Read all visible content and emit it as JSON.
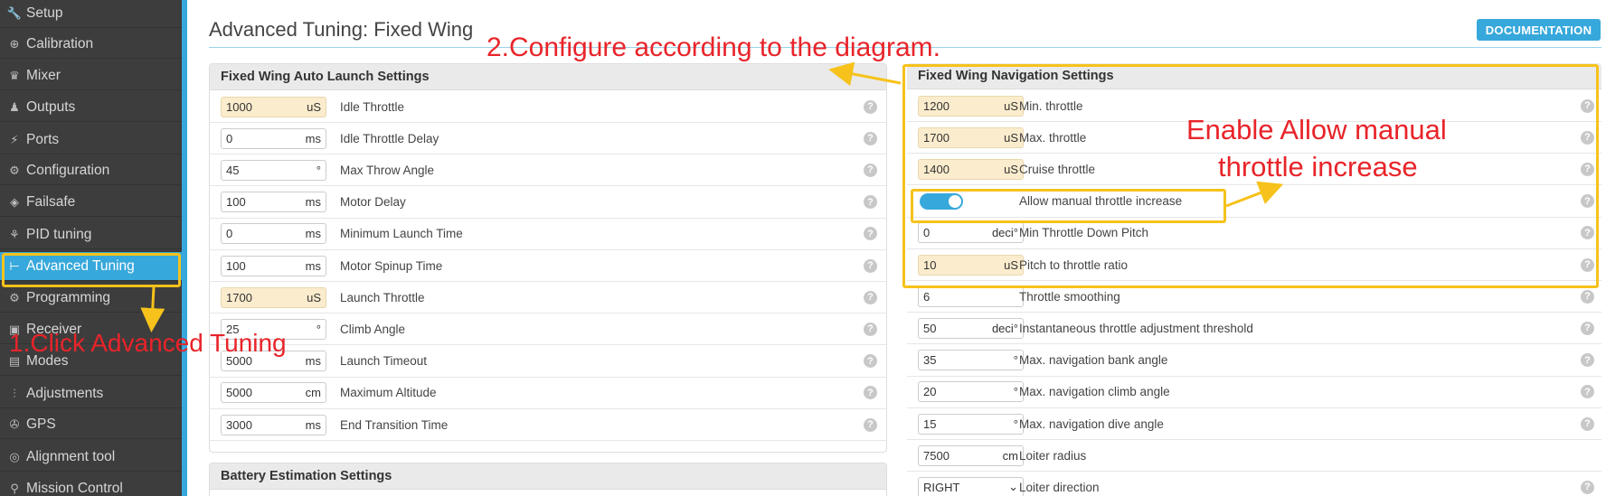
{
  "sidebar": {
    "items": [
      {
        "label": "Setup",
        "icon": "wrench-icon"
      },
      {
        "label": "Calibration",
        "icon": "crosshair-icon"
      },
      {
        "label": "Mixer",
        "icon": "mixer-icon"
      },
      {
        "label": "Outputs",
        "icon": "outputs-icon"
      },
      {
        "label": "Ports",
        "icon": "ports-icon"
      },
      {
        "label": "Configuration",
        "icon": "gear-icon"
      },
      {
        "label": "Failsafe",
        "icon": "failsafe-icon"
      },
      {
        "label": "PID tuning",
        "icon": "pid-icon"
      },
      {
        "label": "Advanced Tuning",
        "icon": "tree-icon"
      },
      {
        "label": "Programming",
        "icon": "gear-icon"
      },
      {
        "label": "Receiver",
        "icon": "receiver-icon"
      },
      {
        "label": "Modes",
        "icon": "modes-icon"
      },
      {
        "label": "Adjustments",
        "icon": "sliders-icon"
      },
      {
        "label": "GPS",
        "icon": "satellite-icon"
      },
      {
        "label": "Alignment tool",
        "icon": "compass-icon"
      },
      {
        "label": "Mission Control",
        "icon": "map-pin-icon"
      }
    ],
    "active_index": 8,
    "active_color": "#37a8db"
  },
  "header": {
    "title": "Advanced Tuning: Fixed Wing",
    "doc_button": "DOCUMENTATION"
  },
  "launch_panel": {
    "title": "Fixed Wing Auto Launch Settings",
    "rows": [
      {
        "value": "1000",
        "unit": "uS",
        "label": "Idle Throttle",
        "warn": true
      },
      {
        "value": "0",
        "unit": "ms",
        "label": "Idle Throttle Delay",
        "warn": false
      },
      {
        "value": "45",
        "unit": "°",
        "label": "Max Throw Angle",
        "warn": false
      },
      {
        "value": "100",
        "unit": "ms",
        "label": "Motor Delay",
        "warn": false
      },
      {
        "value": "0",
        "unit": "ms",
        "label": "Minimum Launch Time",
        "warn": false
      },
      {
        "value": "100",
        "unit": "ms",
        "label": "Motor Spinup Time",
        "warn": false
      },
      {
        "value": "1700",
        "unit": "uS",
        "label": "Launch Throttle",
        "warn": true
      },
      {
        "value": "25",
        "unit": "°",
        "label": "Climb Angle",
        "warn": false
      },
      {
        "value": "5000",
        "unit": "ms",
        "label": "Launch Timeout",
        "warn": false
      },
      {
        "value": "5000",
        "unit": "cm",
        "label": "Maximum Altitude",
        "warn": false
      },
      {
        "value": "3000",
        "unit": "ms",
        "label": "End Transition Time",
        "warn": false
      }
    ]
  },
  "battery_panel": {
    "title": "Battery Estimation Settings"
  },
  "nav_panel": {
    "title": "Fixed Wing Navigation Settings",
    "rows": [
      {
        "type": "field",
        "value": "1200",
        "unit": "uS",
        "label": "Min. throttle",
        "warn": true
      },
      {
        "type": "field",
        "value": "1700",
        "unit": "uS",
        "label": "Max. throttle",
        "warn": true
      },
      {
        "type": "field",
        "value": "1400",
        "unit": "uS",
        "label": "Cruise throttle",
        "warn": true
      },
      {
        "type": "toggle",
        "on": true,
        "label": "Allow manual throttle increase"
      },
      {
        "type": "field",
        "value": "0",
        "unit": "deci°",
        "label": "Min Throttle Down Pitch",
        "warn": false
      },
      {
        "type": "field",
        "value": "10",
        "unit": "uS",
        "label": "Pitch to throttle ratio",
        "warn": true
      },
      {
        "type": "field",
        "value": "6",
        "unit": "",
        "label": "Throttle smoothing",
        "warn": false
      },
      {
        "type": "field",
        "value": "50",
        "unit": "deci°",
        "label": "Instantaneous throttle adjustment threshold",
        "warn": false
      },
      {
        "type": "field",
        "value": "35",
        "unit": "°",
        "label": "Max. navigation bank angle",
        "warn": false
      },
      {
        "type": "field",
        "value": "20",
        "unit": "°",
        "label": "Max. navigation climb angle",
        "warn": false
      },
      {
        "type": "field",
        "value": "15",
        "unit": "°",
        "label": "Max. navigation dive angle",
        "warn": false
      },
      {
        "type": "field",
        "value": "7500",
        "unit": "cm",
        "label": "Loiter radius",
        "warn": false
      },
      {
        "type": "select",
        "value": "RIGHT",
        "label": "Loiter direction"
      }
    ]
  },
  "help_glyph": "?",
  "annotations": {
    "step1": "1.Click Advanced Tuning",
    "step2": "2.Configure according to the diagram.",
    "enable_line1": "Enable Allow manual",
    "enable_line2": "throttle increase",
    "annotation_color": "#e8242a",
    "highlight_color": "#f6c21b"
  }
}
